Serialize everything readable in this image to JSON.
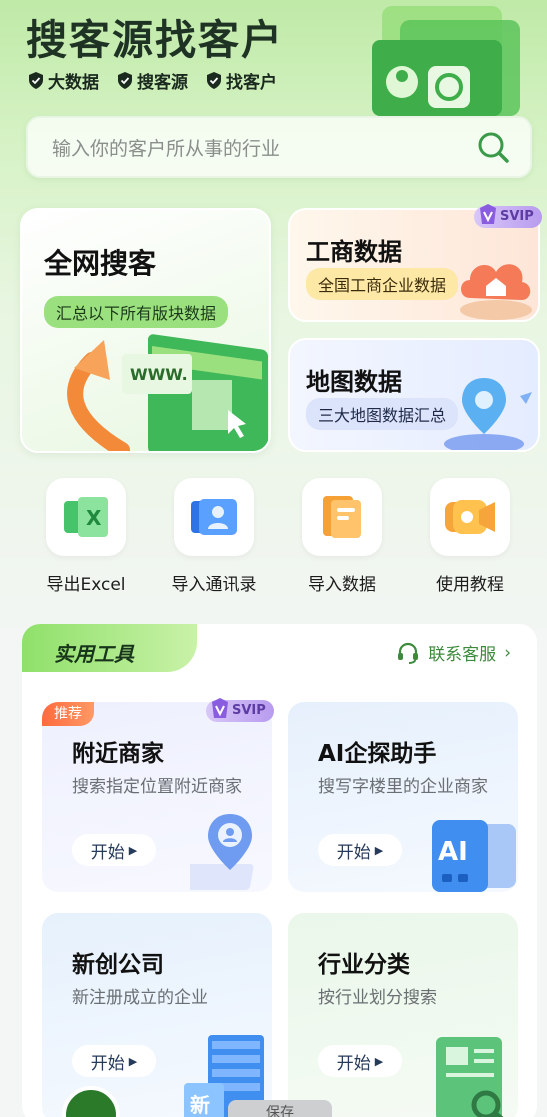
{
  "header": {
    "title": "搜客源找客户",
    "tags": [
      "大数据",
      "搜客源",
      "找客户"
    ]
  },
  "search": {
    "placeholder": "输入你的客户所从事的行业"
  },
  "cards": {
    "all_web": {
      "title": "全网搜客",
      "pill": "汇总以下所有版块数据"
    },
    "business": {
      "title": "工商数据",
      "pill": "全国工商企业数据",
      "badge": "SVIP"
    },
    "map": {
      "title": "地图数据",
      "pill": "三大地图数据汇总"
    }
  },
  "quick_actions": [
    {
      "label": "导出Excel",
      "icon": "excel-icon"
    },
    {
      "label": "导入通讯录",
      "icon": "contacts-icon"
    },
    {
      "label": "导入数据",
      "icon": "import-data-icon"
    },
    {
      "label": "使用教程",
      "icon": "video-tutorial-icon"
    }
  ],
  "tools": {
    "title": "实用工具",
    "service": "联系客服",
    "items": [
      {
        "title": "附近商家",
        "desc": "搜索指定位置附近商家",
        "start": "开始",
        "ribbon": "推荐",
        "badge": "SVIP"
      },
      {
        "title": "AI企探助手",
        "desc": "搜写字楼里的企业商家",
        "start": "开始"
      },
      {
        "title": "新创公司",
        "desc": "新注册成立的企业",
        "start": "开始",
        "illus_text": "新"
      },
      {
        "title": "行业分类",
        "desc": "按行业划分搜索",
        "start": "开始"
      }
    ]
  },
  "bottom": {
    "tab_label": "保存"
  },
  "colors": {
    "accent": "#8fe06a",
    "brand_green": "#3d8a3c",
    "svip": "#b89bef",
    "recommend": "#ff6a3d"
  }
}
